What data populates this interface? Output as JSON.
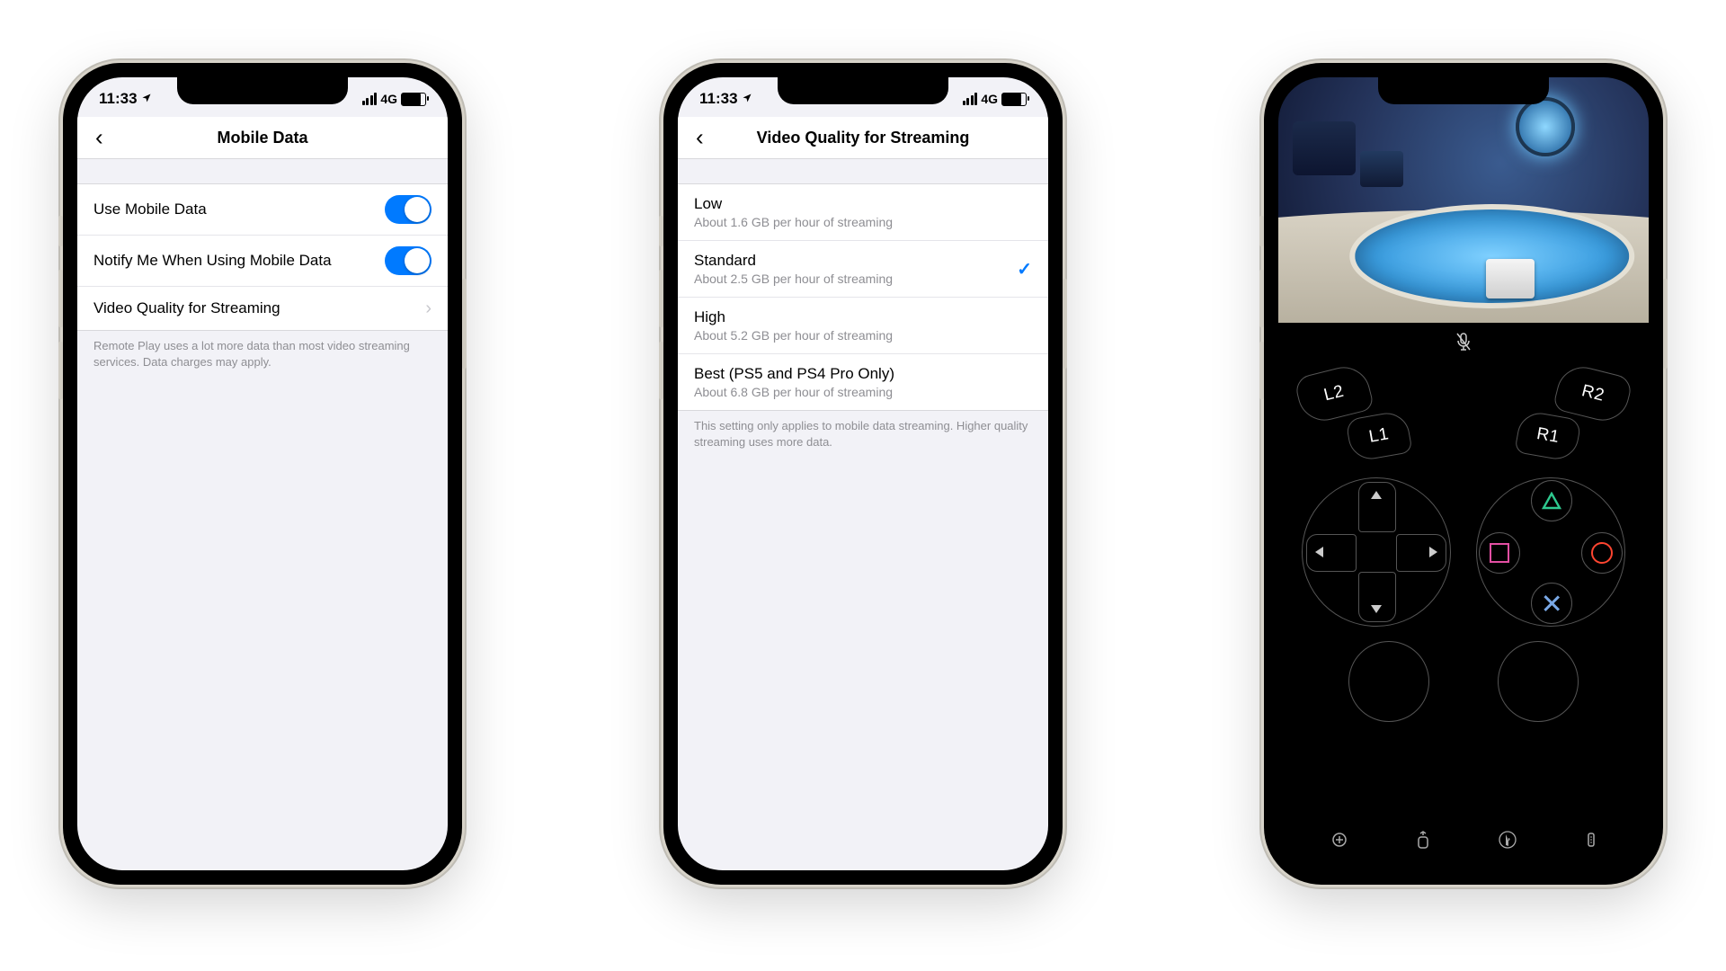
{
  "phone1": {
    "status": {
      "time": "11:33",
      "network": "4G"
    },
    "title": "Mobile Data",
    "rows": {
      "use_mobile": "Use Mobile Data",
      "notify": "Notify Me When Using Mobile Data",
      "quality": "Video Quality for Streaming"
    },
    "footnote": "Remote Play uses a lot more data than most video streaming services. Data charges may apply."
  },
  "phone2": {
    "status": {
      "time": "11:33",
      "network": "4G"
    },
    "title": "Video Quality for Streaming",
    "options": [
      {
        "label": "Low",
        "sub": "About 1.6 GB per hour of streaming"
      },
      {
        "label": "Standard",
        "sub": "About 2.5 GB per hour of streaming"
      },
      {
        "label": "High",
        "sub": "About 5.2 GB per hour of streaming"
      },
      {
        "label": "Best (PS5 and PS4 Pro Only)",
        "sub": "About 6.8 GB per hour of streaming"
      }
    ],
    "selected_index": 1,
    "footnote": "This setting only applies to mobile data streaming. Higher quality streaming uses more data."
  },
  "phone3": {
    "triggers": {
      "l2": "L2",
      "l1": "L1",
      "r2": "R2",
      "r1": "R1"
    }
  }
}
